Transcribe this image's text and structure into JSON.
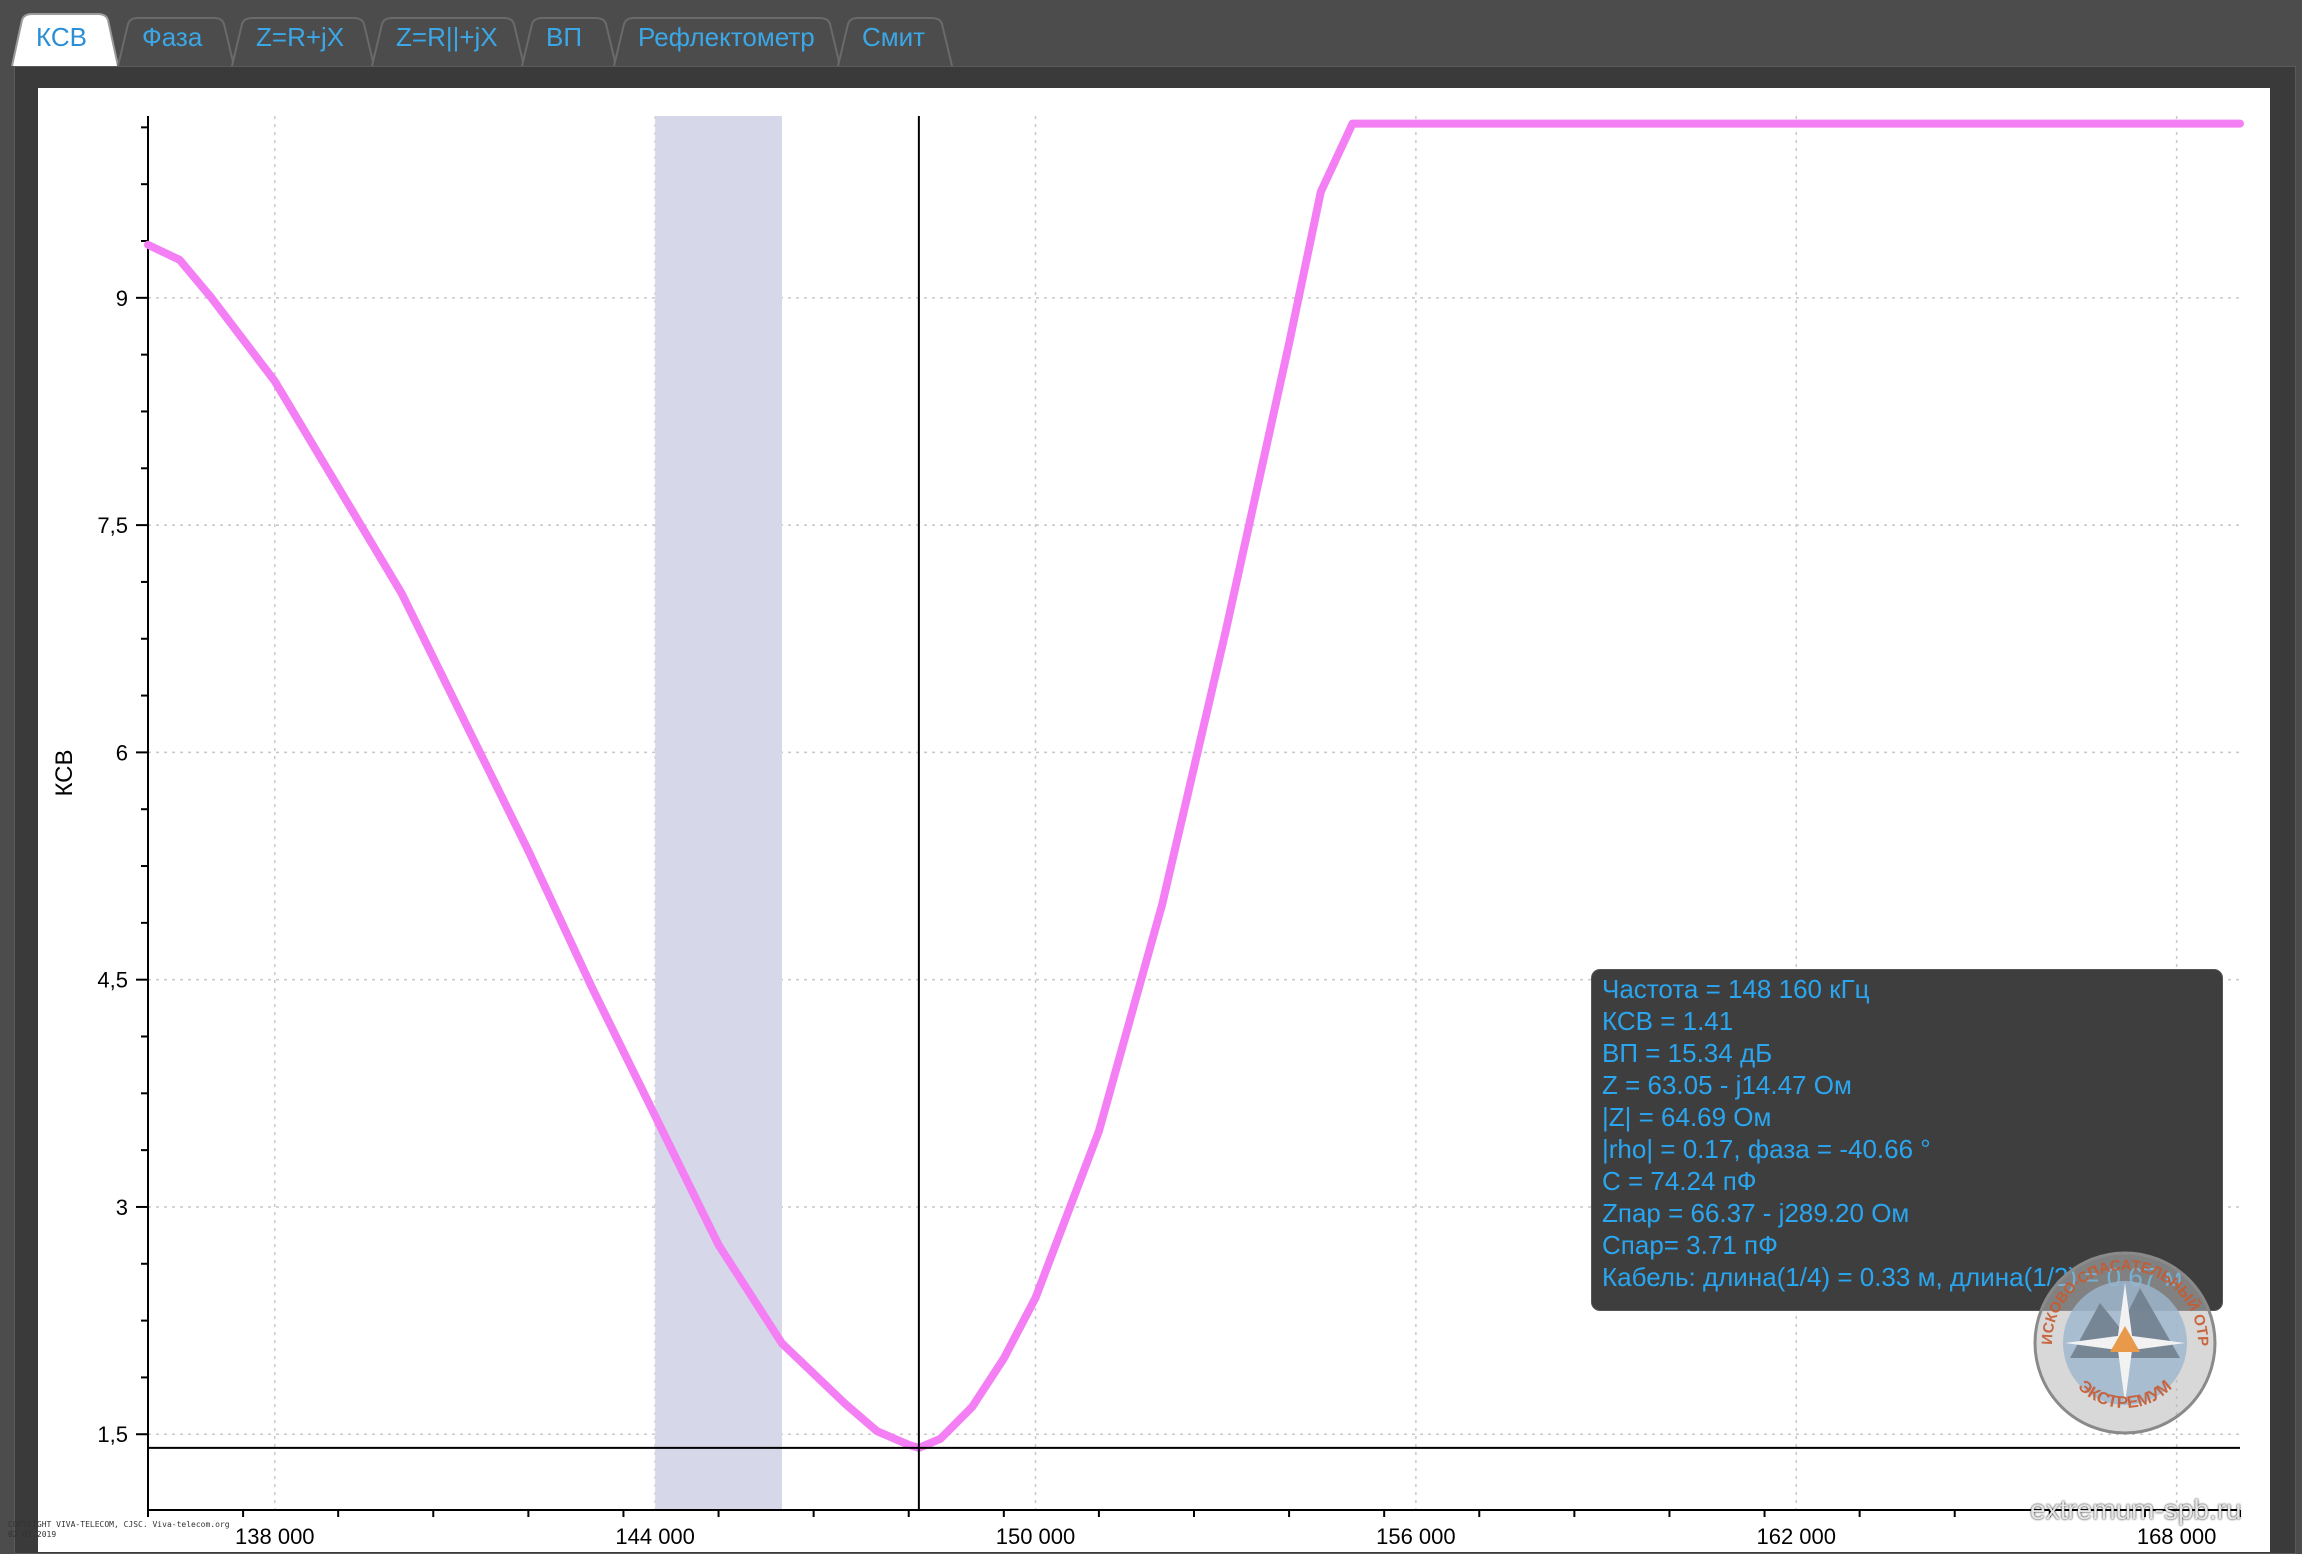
{
  "tabs": [
    {
      "label": "КСВ",
      "active": true
    },
    {
      "label": "Фаза",
      "active": false
    },
    {
      "label": "Z=R+jX",
      "active": false
    },
    {
      "label": "Z=R||+jX",
      "active": false
    },
    {
      "label": "ВП",
      "active": false
    },
    {
      "label": "Рефлектометр",
      "active": false
    },
    {
      "label": "Смит",
      "active": false
    }
  ],
  "tooltip": {
    "lines": [
      "Частота = 148 160 кГц",
      "КСВ = 1.41",
      "ВП = 15.34 дБ",
      "Z = 63.05 - j14.47 Ом",
      "|Z| = 64.69 Ом",
      "|rho| = 0.17, фаза = -40.66 °",
      "C = 74.24 пФ",
      "Zпар = 66.37 - j289.20 Ом",
      "Cпар= 3.71 пФ",
      "Кабель: длина(1/4) = 0.33 м, длина(1/2) = 0.67 м"
    ]
  },
  "watermark": "extremum-spb.ru",
  "logo": {
    "top_text": "ПОИСКОВО-СПАСАТЕЛЬНЫЙ ОТРЯД",
    "bottom_text": "ЭКСТРЕМУМ"
  },
  "copyright": [
    "COPYRIGHT VIVA-TELECOM, CJSC. Viva-telecom.org",
    "02.07.2019"
  ],
  "colors": {
    "curve": "#f47ff4",
    "band": "#d7d7ea",
    "grid": "#c8c8c8",
    "tooltip_text": "#2aa6f0",
    "tab_text": "#3ba7e6"
  },
  "chart_data": {
    "type": "line",
    "xlabel": "",
    "ylabel": "КСВ",
    "xlim": [
      136000,
      169000
    ],
    "ylim": [
      1.0,
      10.2
    ],
    "x_ticks": [
      138000,
      144000,
      150000,
      156000,
      162000,
      168000
    ],
    "x_tick_labels": [
      "138 000",
      "144 000",
      "150 000",
      "156 000",
      "162 000",
      "168 000"
    ],
    "y_ticks": [
      1.5,
      3,
      4.5,
      6,
      7.5,
      9
    ],
    "y_tick_labels": [
      "1,5",
      "3",
      "4,5",
      "6",
      "7,5",
      "9"
    ],
    "grid": true,
    "highlight_band_x": [
      144000,
      146000
    ],
    "marker": {
      "x": 148160,
      "y": 1.41
    },
    "series": [
      {
        "x": [
          136000,
          136500,
          137000,
          138000,
          139000,
          140000,
          141000,
          142000,
          143000,
          144000,
          145000,
          146000,
          147000,
          147500,
          148000,
          148160,
          148500,
          149000,
          149500,
          150000,
          151000,
          152000,
          153000,
          154000,
          154500,
          155000,
          169000
        ],
        "y": [
          9.35,
          9.25,
          9.0,
          8.45,
          7.75,
          7.05,
          6.2,
          5.35,
          4.45,
          3.6,
          2.75,
          2.1,
          1.7,
          1.52,
          1.43,
          1.41,
          1.47,
          1.68,
          2.0,
          2.4,
          3.5,
          5.0,
          6.8,
          8.7,
          9.7,
          10.15,
          10.15
        ]
      }
    ]
  }
}
